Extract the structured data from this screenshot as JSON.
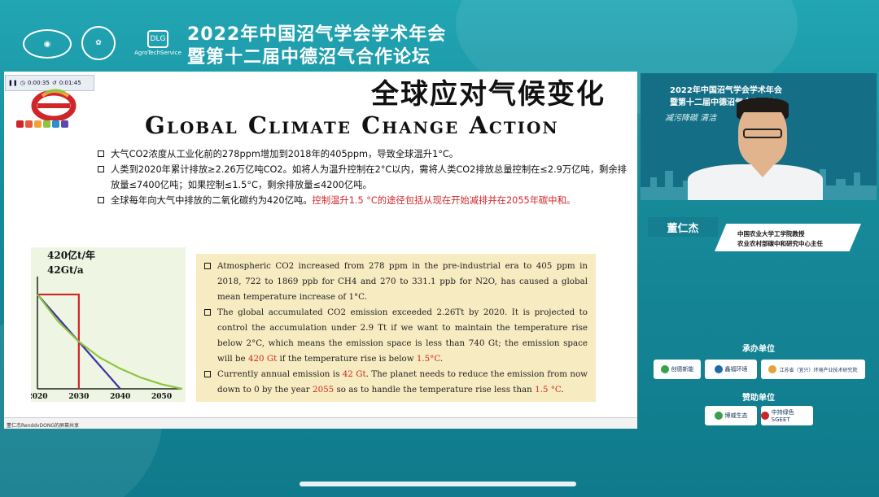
{
  "header": {
    "title_line1": "2022年中国沼气学会学术年会",
    "title_line2": "暨第十二届中德沼气合作论坛",
    "logo3_text": "AgroTechService",
    "logo3_badge": "DLG"
  },
  "player": {
    "elapsed": "0:00:35",
    "remaining": "0:01:45"
  },
  "slide": {
    "cn_title": "全球应对气候变化",
    "en_title": "Global Climate Change Action",
    "bullets": [
      "大气CO2浓度从工业化前的278ppm增加到2018年的405ppm，导致全球温升1°C。",
      "人类到2020年累计排放≥2.26万亿吨CO2。如将人为温升控制在2°C以内，需将人类CO2排放总量控制在≤2.9万亿吨，剩余排放量≤7400亿吨；如果控制≤1.5°C，剩余排放量≤4200亿吨。",
      "全球每年向大气中排放的二氧化碳约为420亿吨。",
      "控制温升1.5 °C的途径包括从现在开始减排并在2055年碳中和。"
    ],
    "en_bullets": {
      "b1": "Atmospheric CO2 increased from 278 ppm in the pre-industrial era to 405 ppm in 2018, 722 to 1869 ppb for CH4 and 270 to 331.1 ppb for N2O, has caused a global mean temperature increase of 1°C.",
      "b2_part1": "The global accumulated CO2 emission exceeded 2.26Tt by 2020. It is projected to control the accumulation under 2.9 Tt if we want to maintain the temperature rise below 2°C, which means the emission space is less than 740  Gt; the emission space will be ",
      "b2_red1": "420 Gt",
      "b2_part2": " if the temperature rise is below ",
      "b2_red2": "1.5°C",
      "b2_end": ".",
      "b3_part1": "Currently annual emission is ",
      "b3_red1": "42 Gt",
      "b3_part2": ". The planet needs to reduce the emission from now down to 0 by the year ",
      "b3_red2": "2055",
      "b3_part3": " so as to handle the temperature rise less than ",
      "b3_red3": "1.5 °C",
      "b3_end": "."
    },
    "bottom_label": "董仁杰RenddvDONG的屏幕共享"
  },
  "chart_data": {
    "type": "line",
    "y_label_1": "420亿t/年",
    "y_label_2": "42Gt/a",
    "x_ticks": [
      "2020",
      "2030",
      "2040",
      "2050"
    ],
    "xlim": [
      2020,
      2055
    ],
    "ylim": [
      0,
      50
    ],
    "series": [
      {
        "x": [
          2020,
          2030,
          2030
        ],
        "y": [
          42,
          42,
          0
        ],
        "color": "#d0262a"
      },
      {
        "x": [
          2020,
          2040
        ],
        "y": [
          42,
          0
        ],
        "color": "#3b2fa8"
      },
      {
        "x": [
          2020,
          2025,
          2030,
          2035,
          2040,
          2045,
          2050,
          2055
        ],
        "y": [
          42,
          30,
          21,
          14,
          9,
          5,
          2,
          0
        ],
        "color": "#8cc63f"
      }
    ]
  },
  "video": {
    "title_line1": "2022年中国沼气学会学术年会",
    "title_line2": "暨第十二届中德沼气合作论坛",
    "tagline": "减污降碳 清洁"
  },
  "speaker": {
    "name": "董仁杰",
    "affil_1": "中国农业大学工学院教授",
    "affil_2": "农业农村部碳中和研究中心主任"
  },
  "sections": {
    "organizer_label": "承办单位",
    "sponsor_label": "赞助单位",
    "organizers": [
      "创德新能",
      "鑫福环境",
      "江苏省（宜兴）环境产业技术研究院"
    ],
    "sponsors": [
      "博威生态",
      "中持绿色 SGEET"
    ]
  }
}
